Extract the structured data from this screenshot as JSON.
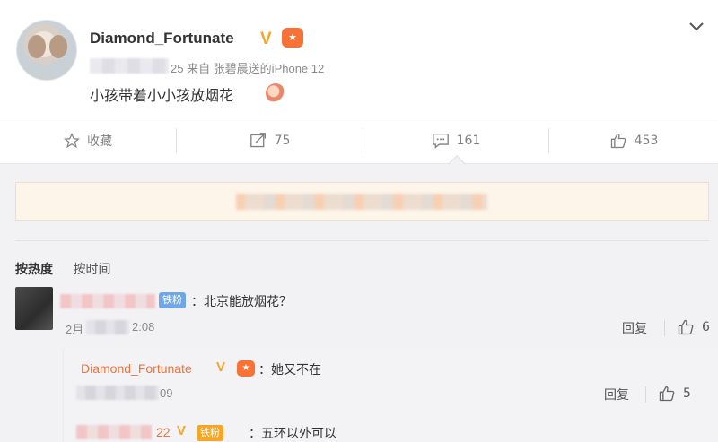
{
  "post": {
    "username": "Diamond_Fortunate",
    "verified_mark": "V",
    "medal_icon": "medal-icon",
    "meta_suffix": "25 来自 张碧晨送的iPhone 12",
    "text": "小孩带着小小孩放烟花",
    "emoji_icon": "fire-face-emoji"
  },
  "actions": {
    "favorite_label": "收藏",
    "repost_count": "75",
    "comment_count": "161",
    "like_count": "453"
  },
  "comments": {
    "sort_hot": "按热度",
    "sort_time": "按时间",
    "first": {
      "badge": "铁粉",
      "text": "：北京能放烟花？",
      "time_suffix": "2:08",
      "time_prefix": "2月",
      "reply_label": "回复",
      "like_count": "6"
    },
    "replies": [
      {
        "username": "Diamond_Fortunate",
        "verified_mark": "V",
        "text": "：她又不在",
        "time_suffix": "09",
        "reply_label": "回复",
        "like_count": "5"
      },
      {
        "name_suffix": "22",
        "verified_mark": "V",
        "badge": "铁粉",
        "text": "：五环以外可以"
      }
    ]
  },
  "colors": {
    "accent_orange": "#eb7340",
    "verified_gold": "#f5a623",
    "fan_badge_blue": "#6fa7e6"
  }
}
